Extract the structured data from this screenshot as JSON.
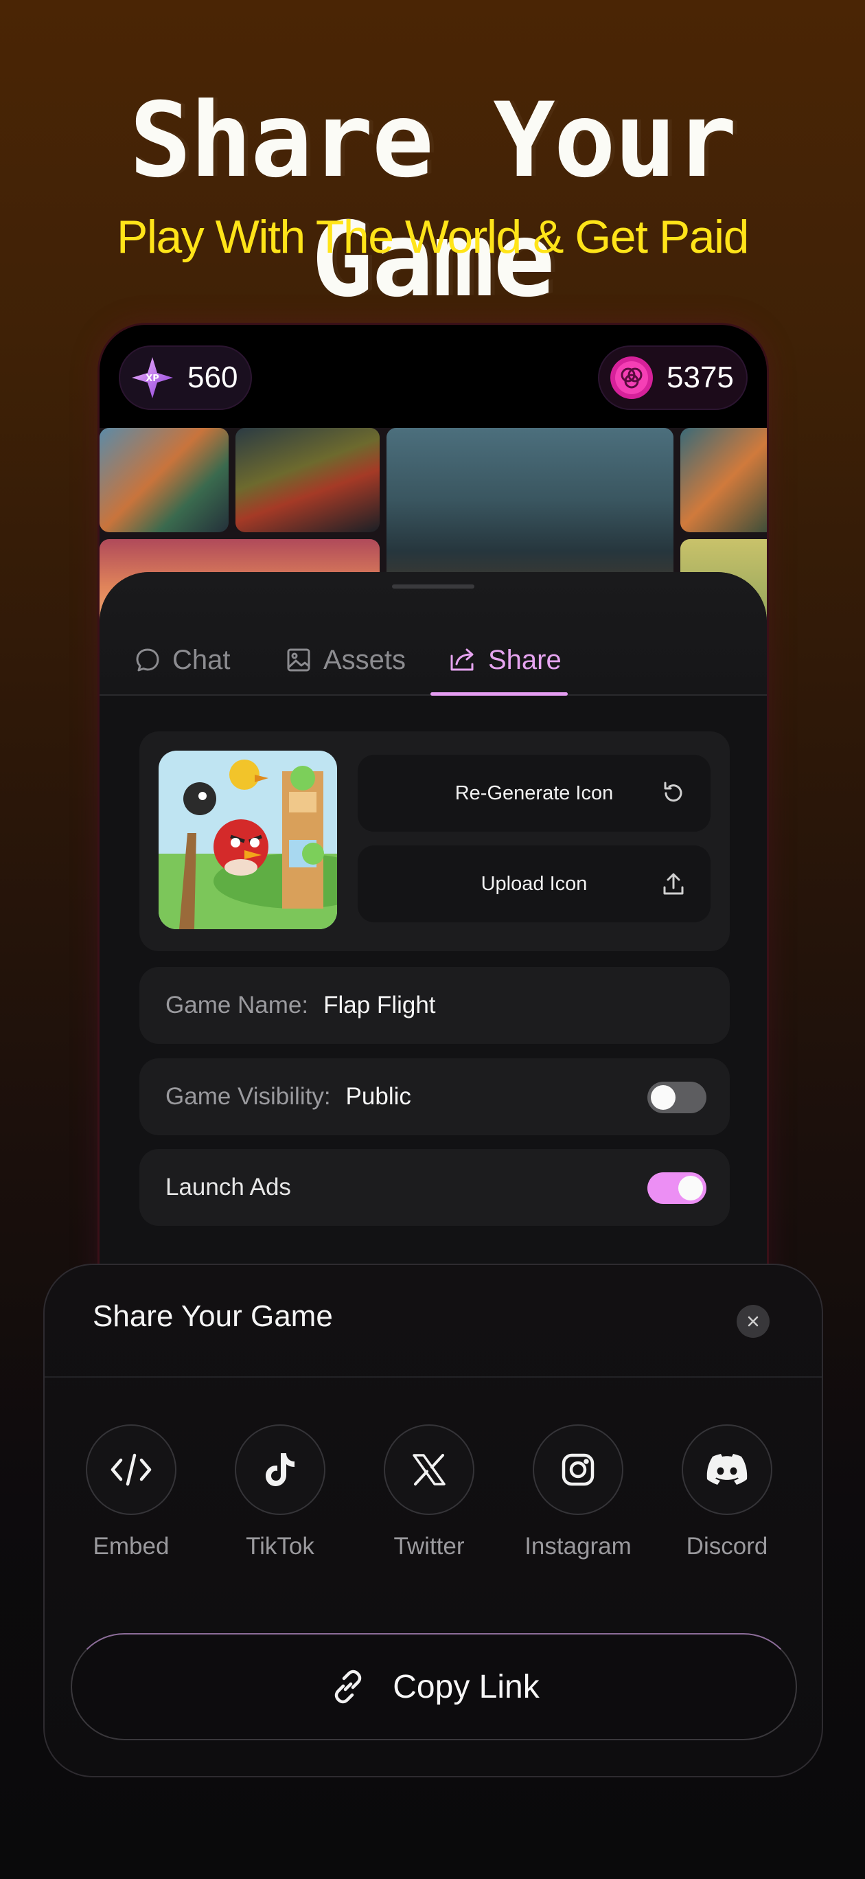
{
  "hero": {
    "title": "Share Your Game",
    "subtitle": "Play With The World & Get Paid"
  },
  "status": {
    "xp_badge_text": "XP",
    "xp_value": "560",
    "coin_value": "5375"
  },
  "tabs": [
    {
      "label": "Chat",
      "icon": "chat-bubble-icon",
      "active": false
    },
    {
      "label": "Assets",
      "icon": "image-icon",
      "active": false
    },
    {
      "label": "Share",
      "icon": "share-icon",
      "active": true
    }
  ],
  "icon_actions": {
    "regenerate_label": "Re-Generate Icon",
    "upload_label": "Upload Icon"
  },
  "fields": {
    "name_label": "Game Name:",
    "name_value": "Flap Flight",
    "visibility_label": "Game Visibility:",
    "visibility_value": "Public",
    "visibility_toggle_on": false,
    "ads_label": "Launch Ads",
    "ads_toggle_on": true
  },
  "share_modal": {
    "title": "Share Your Game",
    "targets": [
      {
        "label": "Embed",
        "icon": "code-icon"
      },
      {
        "label": "TikTok",
        "icon": "tiktok-icon"
      },
      {
        "label": "Twitter",
        "icon": "x-icon"
      },
      {
        "label": "Instagram",
        "icon": "instagram-icon"
      },
      {
        "label": "Discord",
        "icon": "discord-icon"
      }
    ],
    "copy_link_label": "Copy Link"
  },
  "colors": {
    "accent_yellow": "#ffe419",
    "accent_pink": "#e59df2",
    "toggle_on": "#ec8ff4"
  }
}
